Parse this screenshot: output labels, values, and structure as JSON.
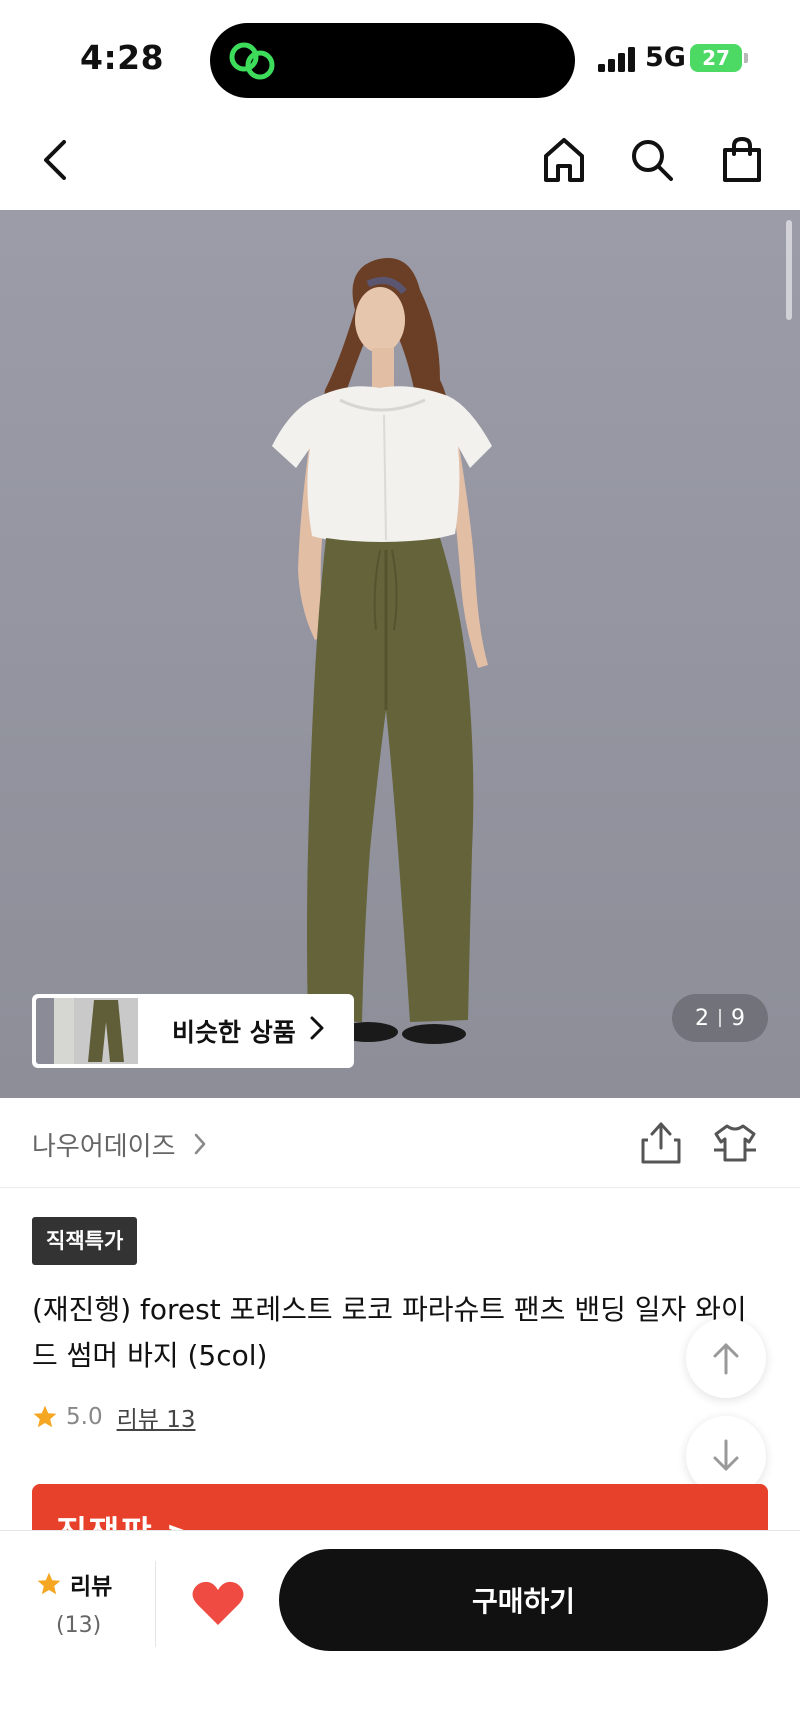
{
  "status_bar": {
    "time": "4:28",
    "network": "5G",
    "battery": "27"
  },
  "nav": {
    "back_icon": "chevron-left-icon",
    "home_icon": "home-icon",
    "search_icon": "search-icon",
    "cart_icon": "shopping-bag-icon"
  },
  "gallery": {
    "similar_label": "비슷한 상품",
    "current_page": "2",
    "total_pages": "9"
  },
  "brand": {
    "name": "나우어데이즈",
    "share_icon": "share-icon",
    "fitting_icon": "tshirt-icon"
  },
  "product": {
    "badge": "직잭특가",
    "title": "(재진행) forest 포레스트 로코 파라슈트 팬츠 밴딩 일자 와이드 썸머 바지 (5col)",
    "rating": "5.0",
    "review_link": "리뷰 13"
  },
  "promo": {
    "text": "직잭팍 >",
    "color": "#e8412b"
  },
  "bottom_bar": {
    "review_label": "리뷰",
    "review_count": "(13)",
    "buy_label": "구매하기",
    "heart_color": "#ef4b43",
    "star_color": "#f5a623"
  }
}
